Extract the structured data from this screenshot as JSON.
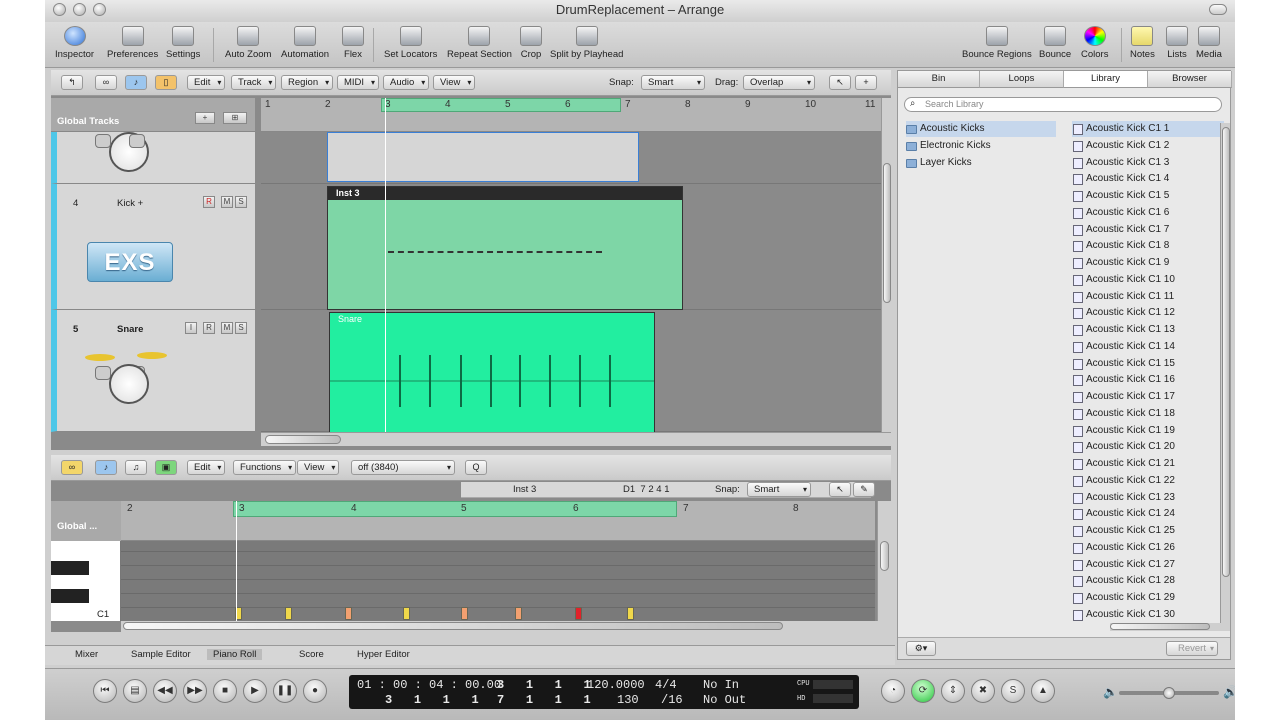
{
  "window": {
    "title": "DrumReplacement – Arrange"
  },
  "toolbar": {
    "left": [
      {
        "label": "Inspector",
        "icon": "info-icon"
      },
      {
        "label": "Preferences",
        "icon": "preferences-icon"
      },
      {
        "label": "Settings",
        "icon": "settings-icon"
      },
      {
        "label": "Auto Zoom",
        "icon": "auto-zoom-icon"
      },
      {
        "label": "Automation",
        "icon": "automation-icon"
      },
      {
        "label": "Flex",
        "icon": "flex-icon"
      },
      {
        "label": "Set Locators",
        "icon": "set-locators-icon"
      },
      {
        "label": "Repeat Section",
        "icon": "repeat-section-icon"
      },
      {
        "label": "Crop",
        "icon": "crop-icon"
      },
      {
        "label": "Split by Playhead",
        "icon": "split-icon"
      }
    ],
    "right": [
      {
        "label": "Bounce Regions",
        "icon": "bounce-regions-icon"
      },
      {
        "label": "Bounce",
        "icon": "bounce-icon"
      },
      {
        "label": "Colors",
        "icon": "colors-icon"
      },
      {
        "label": "Notes",
        "icon": "notes-icon"
      },
      {
        "label": "Lists",
        "icon": "lists-icon"
      },
      {
        "label": "Media",
        "icon": "media-icon"
      }
    ]
  },
  "arrange": {
    "menus": [
      "Edit",
      "Track",
      "Region",
      "MIDI",
      "Audio",
      "View"
    ],
    "snap_label": "Snap:",
    "snap_value": "Smart",
    "drag_label": "Drag:",
    "drag_value": "Overlap",
    "global_tracks": "Global Tracks",
    "ruler": [
      "1",
      "2",
      "3",
      "4",
      "5",
      "6",
      "7",
      "8",
      "9",
      "10",
      "11"
    ],
    "tracks": [
      {
        "number": "4",
        "name": "Kick +",
        "buttons": [
          "R",
          "M",
          "S"
        ],
        "plugin": "EXS",
        "region": "Inst 3"
      },
      {
        "number": "5",
        "name": "Snare",
        "buttons": [
          "I",
          "R",
          "M",
          "S"
        ],
        "region": "Snare"
      }
    ]
  },
  "piano_roll": {
    "menus": [
      "Edit",
      "Functions",
      "View"
    ],
    "quantize": "off (3840)",
    "q_button": "Q",
    "region_name": "Inst 3",
    "position": "D1  7 2 4 1",
    "snap_label": "Snap:",
    "snap_value": "Smart",
    "global_label": "Global ...",
    "ruler": [
      "2",
      "3",
      "4",
      "5",
      "6",
      "7",
      "8"
    ],
    "key_label": "C1",
    "colors": {
      "normal": "#f0d84a",
      "mid": "#f2a070",
      "hot": "#e0222a"
    }
  },
  "bottom_tabs": [
    "Mixer",
    "Sample Editor",
    "Piano Roll",
    "Score",
    "Hyper Editor"
  ],
  "transport": {
    "smpte": "01 : 00 : 04 : 00.00",
    "bars_top": [
      "3",
      "1",
      "1",
      "1"
    ],
    "bars_bottom": [
      "3",
      "1",
      "1",
      "1"
    ],
    "end_top": [
      "7",
      "1",
      "1",
      "1"
    ],
    "end_bottom": [
      "7",
      "1",
      "1",
      "1"
    ],
    "tempo": "120.0000",
    "sig": "4/4",
    "division": "/16",
    "bpm": "130",
    "in": "No In",
    "out": "No Out",
    "cpu": "CPU",
    "hd": "HD"
  },
  "library": {
    "tabs": [
      "Bin",
      "Loops",
      "Library",
      "Browser"
    ],
    "search_placeholder": "Search Library",
    "categories": [
      "Acoustic Kicks",
      "Electronic Kicks",
      "Layer Kicks"
    ],
    "patches": [
      "Acoustic Kick C1 1",
      "Acoustic Kick C1 2",
      "Acoustic Kick C1 3",
      "Acoustic Kick C1 4",
      "Acoustic Kick C1 5",
      "Acoustic Kick C1 6",
      "Acoustic Kick C1 7",
      "Acoustic Kick C1 8",
      "Acoustic Kick C1 9",
      "Acoustic Kick C1 10",
      "Acoustic Kick C1 11",
      "Acoustic Kick C1 12",
      "Acoustic Kick C1 13",
      "Acoustic Kick C1 14",
      "Acoustic Kick C1 15",
      "Acoustic Kick C1 16",
      "Acoustic Kick C1 17",
      "Acoustic Kick C1 18",
      "Acoustic Kick C1 19",
      "Acoustic Kick C1 20",
      "Acoustic Kick C1 21",
      "Acoustic Kick C1 22",
      "Acoustic Kick C1 23",
      "Acoustic Kick C1 24",
      "Acoustic Kick C1 25",
      "Acoustic Kick C1 26",
      "Acoustic Kick C1 27",
      "Acoustic Kick C1 28",
      "Acoustic Kick C1 29",
      "Acoustic Kick C1 30"
    ],
    "revert": "Revert"
  }
}
